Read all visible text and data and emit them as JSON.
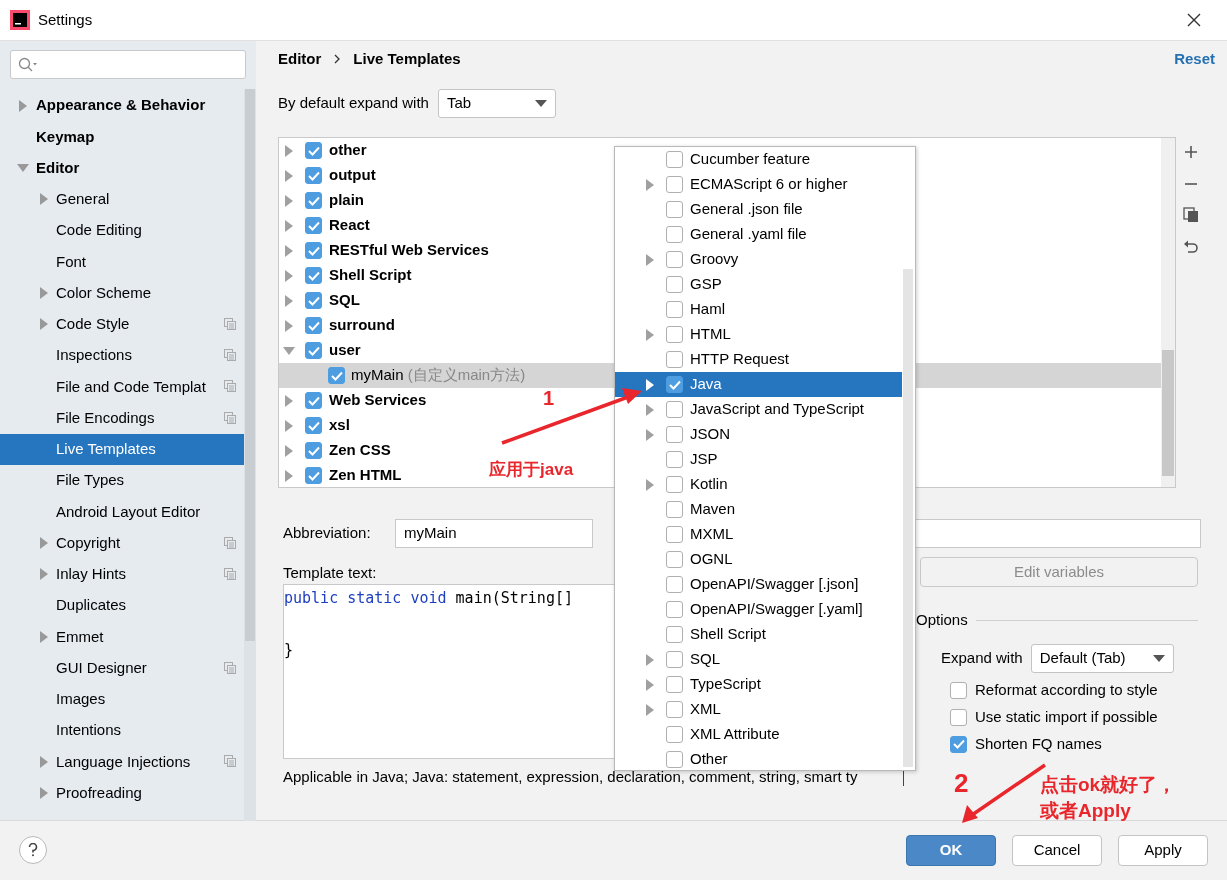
{
  "window": {
    "title": "Settings"
  },
  "sidebar": {
    "items": [
      {
        "label": "Appearance & Behavior",
        "kind": "folder",
        "expanded": false,
        "selected": false,
        "project_level": false
      },
      {
        "label": "Keymap",
        "kind": "leaf",
        "selected": false,
        "project_level": false
      },
      {
        "label": "Editor",
        "kind": "folder",
        "expanded": true,
        "selected": false,
        "project_level": false,
        "children": [
          {
            "label": "General",
            "kind": "folder",
            "expanded": false,
            "selected": false,
            "project_level": false
          },
          {
            "label": "Code Editing",
            "kind": "leaf",
            "selected": false,
            "project_level": false
          },
          {
            "label": "Font",
            "kind": "leaf",
            "selected": false,
            "project_level": false
          },
          {
            "label": "Color Scheme",
            "kind": "folder",
            "expanded": false,
            "selected": false,
            "project_level": false
          },
          {
            "label": "Code Style",
            "kind": "folder",
            "expanded": false,
            "selected": false,
            "project_level": true
          },
          {
            "label": "Inspections",
            "kind": "leaf",
            "selected": false,
            "project_level": true
          },
          {
            "label": "File and Code Templat",
            "kind": "leaf",
            "selected": false,
            "project_level": true
          },
          {
            "label": "File Encodings",
            "kind": "leaf",
            "selected": false,
            "project_level": true
          },
          {
            "label": "Live Templates",
            "kind": "leaf",
            "selected": true,
            "project_level": false
          },
          {
            "label": "File Types",
            "kind": "leaf",
            "selected": false,
            "project_level": false
          },
          {
            "label": "Android Layout Editor",
            "kind": "leaf",
            "selected": false,
            "project_level": false
          },
          {
            "label": "Copyright",
            "kind": "folder",
            "expanded": false,
            "selected": false,
            "project_level": true
          },
          {
            "label": "Inlay Hints",
            "kind": "folder",
            "expanded": false,
            "selected": false,
            "project_level": true
          },
          {
            "label": "Duplicates",
            "kind": "leaf",
            "selected": false,
            "project_level": false
          },
          {
            "label": "Emmet",
            "kind": "folder",
            "expanded": false,
            "selected": false,
            "project_level": false
          },
          {
            "label": "GUI Designer",
            "kind": "leaf",
            "selected": false,
            "project_level": true
          },
          {
            "label": "Images",
            "kind": "leaf",
            "selected": false,
            "project_level": false
          },
          {
            "label": "Intentions",
            "kind": "leaf",
            "selected": false,
            "project_level": false
          },
          {
            "label": "Language Injections",
            "kind": "folder",
            "expanded": false,
            "selected": false,
            "project_level": true
          },
          {
            "label": "Proofreading",
            "kind": "folder",
            "expanded": false,
            "selected": false,
            "project_level": false
          }
        ]
      }
    ]
  },
  "breadcrumb": [
    "Editor",
    "Live Templates"
  ],
  "reset_link": "Reset",
  "default_expand": {
    "label": "By default expand with",
    "value": "Tab"
  },
  "template_groups": [
    {
      "label": "other",
      "checked": true,
      "expanded": false
    },
    {
      "label": "output",
      "checked": true,
      "expanded": false
    },
    {
      "label": "plain",
      "checked": true,
      "expanded": false
    },
    {
      "label": "React",
      "checked": true,
      "expanded": false
    },
    {
      "label": "RESTful Web Services",
      "checked": true,
      "expanded": false
    },
    {
      "label": "Shell Script",
      "checked": true,
      "expanded": false
    },
    {
      "label": "SQL",
      "checked": true,
      "expanded": false
    },
    {
      "label": "surround",
      "checked": true,
      "expanded": false
    },
    {
      "label": "user",
      "checked": true,
      "expanded": true,
      "children": [
        {
          "label": "myMain",
          "description": "(自定义main方法)",
          "checked": true,
          "selected": true
        }
      ]
    },
    {
      "label": "Web Services",
      "checked": true,
      "expanded": false
    },
    {
      "label": "xsl",
      "checked": true,
      "expanded": false
    },
    {
      "label": "Zen CSS",
      "checked": true,
      "expanded": false
    },
    {
      "label": "Zen HTML",
      "checked": true,
      "expanded": false
    }
  ],
  "context_popup": {
    "items": [
      {
        "label": "Cucumber feature",
        "kind": "leaf",
        "checked": false,
        "selected": false
      },
      {
        "label": "ECMAScript 6 or higher",
        "kind": "folder",
        "checked": false,
        "selected": false
      },
      {
        "label": "General .json file",
        "kind": "leaf",
        "checked": false,
        "selected": false
      },
      {
        "label": "General .yaml file",
        "kind": "leaf",
        "checked": false,
        "selected": false
      },
      {
        "label": "Groovy",
        "kind": "folder",
        "checked": false,
        "selected": false
      },
      {
        "label": "GSP",
        "kind": "leaf",
        "checked": false,
        "selected": false
      },
      {
        "label": "Haml",
        "kind": "leaf",
        "checked": false,
        "selected": false
      },
      {
        "label": "HTML",
        "kind": "folder",
        "checked": false,
        "selected": false
      },
      {
        "label": "HTTP Request",
        "kind": "leaf",
        "checked": false,
        "selected": false
      },
      {
        "label": "Java",
        "kind": "folder",
        "checked": true,
        "selected": true
      },
      {
        "label": "JavaScript and TypeScript",
        "kind": "folder",
        "checked": false,
        "selected": false
      },
      {
        "label": "JSON",
        "kind": "folder",
        "checked": false,
        "selected": false
      },
      {
        "label": "JSP",
        "kind": "leaf",
        "checked": false,
        "selected": false
      },
      {
        "label": "Kotlin",
        "kind": "folder",
        "checked": false,
        "selected": false
      },
      {
        "label": "Maven",
        "kind": "leaf",
        "checked": false,
        "selected": false
      },
      {
        "label": "MXML",
        "kind": "leaf",
        "checked": false,
        "selected": false
      },
      {
        "label": "OGNL",
        "kind": "leaf",
        "checked": false,
        "selected": false
      },
      {
        "label": "OpenAPI/Swagger [.json]",
        "kind": "leaf",
        "checked": false,
        "selected": false
      },
      {
        "label": "OpenAPI/Swagger [.yaml]",
        "kind": "leaf",
        "checked": false,
        "selected": false
      },
      {
        "label": "Shell Script",
        "kind": "leaf",
        "checked": false,
        "selected": false
      },
      {
        "label": "SQL",
        "kind": "folder",
        "checked": false,
        "selected": false
      },
      {
        "label": "TypeScript",
        "kind": "folder",
        "checked": false,
        "selected": false
      },
      {
        "label": "XML",
        "kind": "folder",
        "checked": false,
        "selected": false
      },
      {
        "label": "XML Attribute",
        "kind": "leaf",
        "checked": false,
        "selected": false
      },
      {
        "label": "Other",
        "kind": "leaf",
        "checked": false,
        "selected": false
      }
    ]
  },
  "abbreviation": {
    "label": "Abbreviation:",
    "value": "myMain"
  },
  "template_text": {
    "label": "Template text:",
    "lines": [
      [
        {
          "text": "public static void",
          "kind": "keyword"
        },
        {
          "text": " main(String[]",
          "kind": "plain"
        }
      ],
      [
        {
          "text": "}",
          "kind": "plain"
        }
      ]
    ]
  },
  "edit_variables_button": {
    "label": "Edit variables",
    "disabled": true
  },
  "options": {
    "title": "Options",
    "expand_with": {
      "label": "Expand with",
      "value": "Default (Tab)"
    },
    "checkboxes": [
      {
        "label": "Reformat according to style",
        "checked": false
      },
      {
        "label": "Use static import if possible",
        "checked": false
      },
      {
        "label": "Shorten FQ names",
        "checked": true
      }
    ]
  },
  "applicable_text": "Applicable in Java; Java: statement, expression, declaration, comment, string, smart ty",
  "buttons": [
    {
      "label": "OK",
      "kind": "primary"
    },
    {
      "label": "Cancel",
      "kind": "default"
    },
    {
      "label": "Apply",
      "kind": "default"
    }
  ],
  "annotations": {
    "step_1": "1",
    "note_1": "应用于java",
    "step_2": "2",
    "note_2": [
      "点击ok就好了，",
      "或者Apply"
    ]
  }
}
